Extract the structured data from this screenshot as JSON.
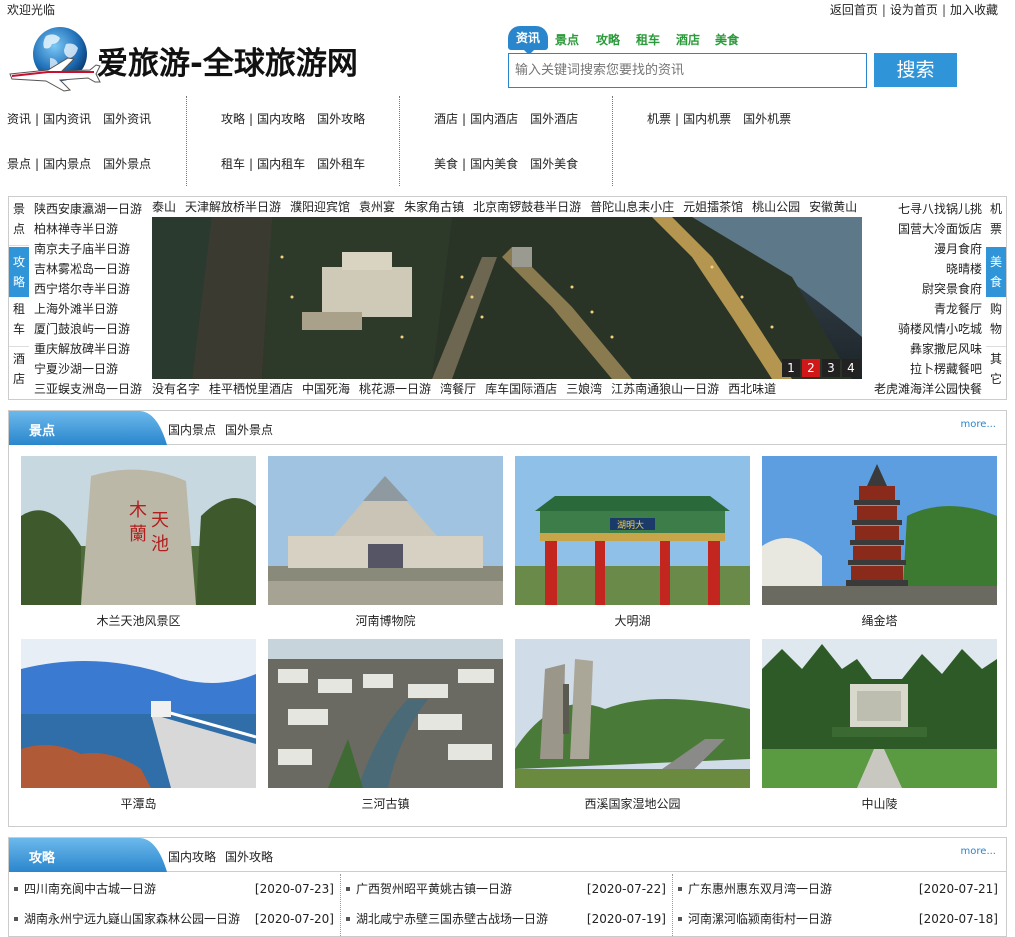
{
  "topbar": {
    "welcome": "欢迎光临",
    "links": [
      "返回首页",
      "设为首页",
      "加入收藏"
    ]
  },
  "site": {
    "name": "爱旅游-全球旅游网",
    "logo_icon": "globe-airplane-icon"
  },
  "search": {
    "tabs": [
      "资讯",
      "景点",
      "攻略",
      "租车",
      "酒店",
      "美食"
    ],
    "placeholder": "输入关键词搜索您要找的资讯",
    "button": "搜索",
    "accent": "#2a86cc",
    "tab_color": "#2b9a3a"
  },
  "nav": [
    {
      "rows": [
        [
          "资讯",
          "国内资讯",
          "国外资讯"
        ],
        [
          "景点",
          "国内景点",
          "国外景点"
        ]
      ]
    },
    {
      "rows": [
        [
          "攻略",
          "国内攻略",
          "国外攻略"
        ],
        [
          "租车",
          "国内租车",
          "国外租车"
        ]
      ]
    },
    {
      "rows": [
        [
          "酒店",
          "国内酒店",
          "国外酒店"
        ],
        [
          "美食",
          "国内美食",
          "国外美食"
        ]
      ]
    },
    {
      "rows": [
        [
          "机票",
          "国内机票",
          "国外机票"
        ]
      ]
    }
  ],
  "hero": {
    "left_tabs": [
      "景点",
      "攻略",
      "租车",
      "酒店"
    ],
    "left_active": 1,
    "right_tabs": [
      "机票",
      "美食",
      "购物",
      "其它"
    ],
    "right_active": 1,
    "left_list": [
      "陕西安康瀛湖一日游",
      "柏林禅寺半日游",
      "南京夫子庙半日游",
      "吉林雾凇岛一日游",
      "西宁塔尔寺半日游",
      "上海外滩半日游",
      "厦门鼓浪屿一日游",
      "重庆解放碑半日游",
      "宁夏沙湖一日游",
      "三亚蜈支洲岛一日游"
    ],
    "right_list": [
      "七寻八找锅儿挑",
      "国营大冷面饭店",
      "漫月食府",
      "晓晴楼",
      "尉突景食府",
      "青龙餐厅",
      "骑楼风情小吃城",
      "彝家撒尼风味",
      "拉卜楞藏餐吧",
      "老虎滩海洋公园快餐"
    ],
    "top_links": [
      "泰山",
      "天津解放桥半日游",
      "濮阳迎宾馆",
      "袁州宴",
      "朱家角古镇",
      "北京南锣鼓巷半日游",
      "普陀山息耒小庄",
      "元姐擂茶馆",
      "桃山公园",
      "安徽黄山"
    ],
    "bottom_links": [
      "没有名字",
      "桂平栖悦里酒店",
      "中国死海",
      "桃花源一日游",
      "湾餐厅",
      "库车国际酒店",
      "三娘湾",
      "江苏南通狼山一日游",
      "西北味道"
    ],
    "dots": [
      "1",
      "2",
      "3",
      "4"
    ],
    "active_dot": 1
  },
  "scenic": {
    "title": "景点",
    "sub": [
      "国内景点",
      "国外景点"
    ],
    "more": "more...",
    "items": [
      "木兰天池风景区",
      "河南博物院",
      "大明湖",
      "绳金塔",
      "平潭岛",
      "三河古镇",
      "西溪国家湿地公园",
      "中山陵"
    ]
  },
  "guide": {
    "title": "攻略",
    "sub": [
      "国内攻略",
      "国外攻略"
    ],
    "more": "more...",
    "news": [
      {
        "title": "四川南充阆中古城一日游",
        "date": "[2020-07-23]"
      },
      {
        "title": "广西贺州昭平黄姚古镇一日游",
        "date": "[2020-07-22]"
      },
      {
        "title": "广东惠州惠东双月湾一日游",
        "date": "[2020-07-21]"
      },
      {
        "title": "湖南永州宁远九嶷山国家森林公园一日游",
        "date": "[2020-07-20]"
      },
      {
        "title": "湖北咸宁赤壁三国赤壁古战场一日游",
        "date": "[2020-07-19]"
      },
      {
        "title": "河南漯河临颍南街村一日游",
        "date": "[2020-07-18]"
      }
    ]
  }
}
